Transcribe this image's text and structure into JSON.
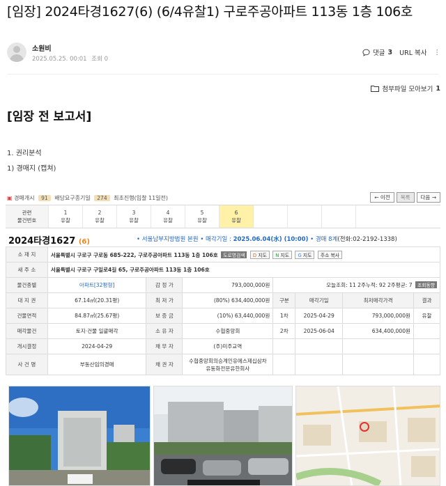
{
  "post": {
    "title": "[임장] 2024타경1627(6) (6/4유찰1) 구로주공아파트 113동 1층 106호",
    "author": "소원비",
    "date": "2025.05.25. 00:01",
    "views_label": "조회 0",
    "comments_label": "댓글",
    "comments_count": "3",
    "url_copy": "URL 복사",
    "more_icon": "⋮",
    "attachments_label": "첨부파일 모아보기",
    "attachments_count": "1",
    "heading": "[임장 전 보고서]",
    "line1": "1. 권리분석",
    "line2": "1) 경매지 (캡쳐)"
  },
  "capture": {
    "stats": {
      "auction_label": "경매개시",
      "auction_count": "91",
      "dividend_label": "배당요구종기일",
      "dividend_count": "274",
      "latest": "최초진행(입찰 11일전)"
    },
    "nav": {
      "prev": "← 이전",
      "list": "목록",
      "next": "다음 →"
    },
    "stages": {
      "header": "관련\n물건번호",
      "items": [
        {
          "no": "1",
          "status": "유찰"
        },
        {
          "no": "2",
          "status": "유찰"
        },
        {
          "no": "3",
          "status": "유찰"
        },
        {
          "no": "4",
          "status": "유찰"
        },
        {
          "no": "5",
          "status": "유찰"
        },
        {
          "no": "6",
          "status": "유찰"
        }
      ]
    },
    "case": {
      "year_no": "2024타경1627",
      "item": "(6)",
      "court": "• 서울남부지방법원 본원",
      "sale_label": "• 매각기일 : ",
      "sale_date": "2025.06.04(水) (10:00)",
      "dept": "• 경매 8계",
      "phone": "(전화:02-2192-1338)"
    },
    "addr": {
      "loc_label": "소 재 지",
      "loc": "서울특별시 구로구 구로동 685-222, 구로주공아파트 113동 1층 106호",
      "road_btn": "도로명검색",
      "map1": "지도",
      "map2": "지도",
      "map3": "지도",
      "copy_btn": "주소 복사",
      "new_label": "새 주 소",
      "new": "서울특별시 구로구 구일로4길 65, 구로주공아파트 113동 1층 106호"
    },
    "rows": [
      {
        "l1": "물건종별",
        "v1": "아파트[32평형]",
        "l2": "감 정 가",
        "v2": "793,000,000원"
      },
      {
        "l1": "대 지 권",
        "v1": "67.14㎡(20.31평)",
        "l2": "최 저 가",
        "v2": "(80%) 634,400,000원"
      },
      {
        "l1": "건물면적",
        "v1": "84.87㎡(25.67평)",
        "l2": "보 증 금",
        "v2": "(10%) 63,440,000원"
      },
      {
        "l1": "매각물건",
        "v1": "토지·건물 일괄매각",
        "l2": "소 유 자",
        "v2": "수협중앙회"
      },
      {
        "l1": "개시결정",
        "v1": "2024-04-29",
        "l2": "채 무 자",
        "v2": "(주)미주교역"
      },
      {
        "l1": "사 건 명",
        "v1": "부동산임의경매",
        "l2": "채 권 자",
        "v2a": "수협중앙회의승계인유에스제십삼차",
        "v2b": "유동화전문유한회사"
      }
    ],
    "history": {
      "views": "오늘조회: 11  2주누적: 92  2주평균: 7",
      "views_btn": "조회동향",
      "h_round": "구분",
      "h_date": "매각기일",
      "h_min": "최저매각가격",
      "h_result": "결과",
      "items": [
        {
          "round": "1차",
          "date": "2025-04-29",
          "min": "793,000,000원",
          "result": "유찰"
        },
        {
          "round": "2차",
          "date": "2025-06-04",
          "min": "634,400,000원",
          "result": ""
        }
      ]
    }
  },
  "colors": {
    "accent_orange": "#e8871e",
    "link_blue": "#2468c4",
    "highlight": "#fff1a8"
  }
}
